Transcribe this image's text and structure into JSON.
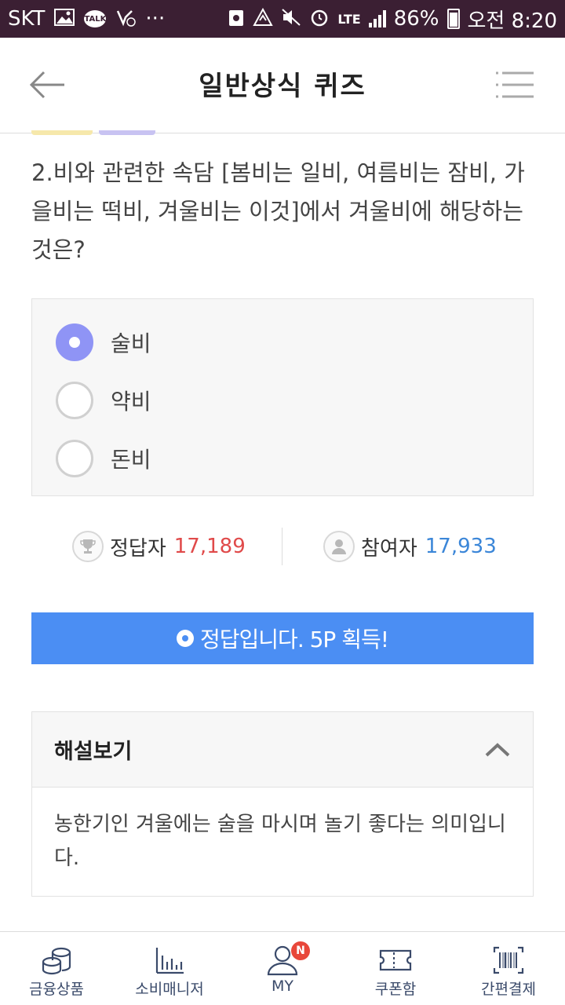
{
  "status_bar": {
    "carrier": "SKT",
    "talk_label": "TALK",
    "more": "···",
    "network": "LTE",
    "battery_percent": "86%",
    "time": "오전 8:20"
  },
  "header": {
    "title": "일반상식 퀴즈"
  },
  "question": {
    "text": "2.비와 관련한 속담 [봄비는 일비, 여름비는 잠비, 가을비는 떡비, 겨울비는 이것]에서 겨울비에 해당하는 것은?"
  },
  "options": [
    {
      "label": "술비",
      "selected": true
    },
    {
      "label": "약비",
      "selected": false
    },
    {
      "label": "돈비",
      "selected": false
    }
  ],
  "stats": {
    "correct_label": "정답자",
    "correct_value": "17,189",
    "correct_color": "#e04a4a",
    "participants_label": "참여자",
    "participants_value": "17,933",
    "participants_color": "#3b86d8"
  },
  "result": {
    "text": "정답입니다. 5P 획득!",
    "color": "#4b8ef3"
  },
  "explanation": {
    "title": "해설보기",
    "body": "농한기인 겨울에는 술을 마시며 놀기 좋다는 의미입니다."
  },
  "bottom_nav": [
    {
      "label": "금융상품",
      "icon": "coins-icon"
    },
    {
      "label": "소비매니저",
      "icon": "bar-chart-icon"
    },
    {
      "label": "MY",
      "icon": "person-icon",
      "badge": "N"
    },
    {
      "label": "쿠폰함",
      "icon": "ticket-icon"
    },
    {
      "label": "간편결제",
      "icon": "barcode-icon"
    }
  ]
}
